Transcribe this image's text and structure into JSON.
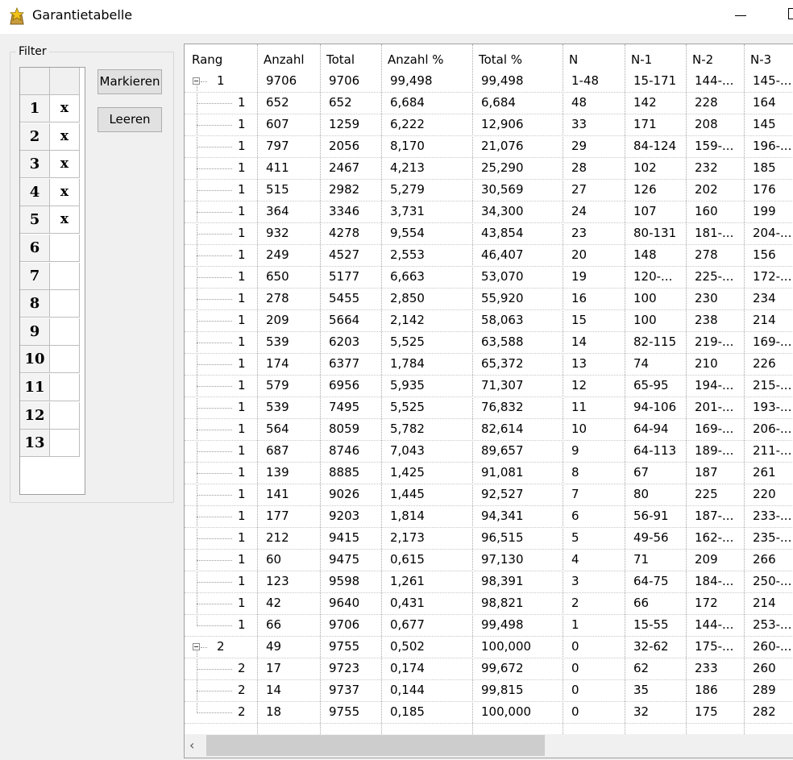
{
  "window": {
    "title": "Garantietabelle",
    "icon": "star-bag-icon"
  },
  "filter": {
    "legend": "Filter",
    "rows": [
      {
        "num": "1",
        "val": "x"
      },
      {
        "num": "2",
        "val": "x"
      },
      {
        "num": "3",
        "val": "x"
      },
      {
        "num": "4",
        "val": "x"
      },
      {
        "num": "5",
        "val": "x"
      },
      {
        "num": "6",
        "val": ""
      },
      {
        "num": "7",
        "val": ""
      },
      {
        "num": "8",
        "val": ""
      },
      {
        "num": "9",
        "val": ""
      },
      {
        "num": "10",
        "val": ""
      },
      {
        "num": "11",
        "val": ""
      },
      {
        "num": "12",
        "val": ""
      },
      {
        "num": "13",
        "val": ""
      }
    ],
    "mark_button": "Markieren",
    "clear_button": "Leeren"
  },
  "table": {
    "columns": [
      "Rang",
      "Anzahl",
      "Total",
      "Anzahl %",
      "Total %",
      "N",
      "N-1",
      "N-2",
      "N-3"
    ],
    "rows": [
      {
        "level": 0,
        "rang": "1",
        "cells": [
          "9706",
          "9706",
          "99,498",
          "99,498",
          "1-48",
          "15-171",
          "144-...",
          "145-..."
        ]
      },
      {
        "level": 1,
        "rang": "1",
        "cells": [
          "652",
          "652",
          "6,684",
          "6,684",
          "48",
          "142",
          "228",
          "164"
        ]
      },
      {
        "level": 1,
        "rang": "1",
        "cells": [
          "607",
          "1259",
          "6,222",
          "12,906",
          "33",
          "171",
          "208",
          "145"
        ]
      },
      {
        "level": 1,
        "rang": "1",
        "cells": [
          "797",
          "2056",
          "8,170",
          "21,076",
          "29",
          "84-124",
          "159-...",
          "196-..."
        ]
      },
      {
        "level": 1,
        "rang": "1",
        "cells": [
          "411",
          "2467",
          "4,213",
          "25,290",
          "28",
          "102",
          "232",
          "185"
        ]
      },
      {
        "level": 1,
        "rang": "1",
        "cells": [
          "515",
          "2982",
          "5,279",
          "30,569",
          "27",
          "126",
          "202",
          "176"
        ]
      },
      {
        "level": 1,
        "rang": "1",
        "cells": [
          "364",
          "3346",
          "3,731",
          "34,300",
          "24",
          "107",
          "160",
          "199"
        ]
      },
      {
        "level": 1,
        "rang": "1",
        "cells": [
          "932",
          "4278",
          "9,554",
          "43,854",
          "23",
          "80-131",
          "181-...",
          "204-..."
        ]
      },
      {
        "level": 1,
        "rang": "1",
        "cells": [
          "249",
          "4527",
          "2,553",
          "46,407",
          "20",
          "148",
          "278",
          "156"
        ]
      },
      {
        "level": 1,
        "rang": "1",
        "cells": [
          "650",
          "5177",
          "6,663",
          "53,070",
          "19",
          "120-...",
          "225-...",
          "172-..."
        ]
      },
      {
        "level": 1,
        "rang": "1",
        "cells": [
          "278",
          "5455",
          "2,850",
          "55,920",
          "16",
          "100",
          "230",
          "234"
        ]
      },
      {
        "level": 1,
        "rang": "1",
        "cells": [
          "209",
          "5664",
          "2,142",
          "58,063",
          "15",
          "100",
          "238",
          "214"
        ]
      },
      {
        "level": 1,
        "rang": "1",
        "cells": [
          "539",
          "6203",
          "5,525",
          "63,588",
          "14",
          "82-115",
          "219-...",
          "169-..."
        ]
      },
      {
        "level": 1,
        "rang": "1",
        "cells": [
          "174",
          "6377",
          "1,784",
          "65,372",
          "13",
          "74",
          "210",
          "226"
        ]
      },
      {
        "level": 1,
        "rang": "1",
        "cells": [
          "579",
          "6956",
          "5,935",
          "71,307",
          "12",
          "65-95",
          "194-...",
          "215-..."
        ]
      },
      {
        "level": 1,
        "rang": "1",
        "cells": [
          "539",
          "7495",
          "5,525",
          "76,832",
          "11",
          "94-106",
          "201-...",
          "193-..."
        ]
      },
      {
        "level": 1,
        "rang": "1",
        "cells": [
          "564",
          "8059",
          "5,782",
          "82,614",
          "10",
          "64-94",
          "169-...",
          "206-..."
        ]
      },
      {
        "level": 1,
        "rang": "1",
        "cells": [
          "687",
          "8746",
          "7,043",
          "89,657",
          "9",
          "64-113",
          "189-...",
          "211-..."
        ]
      },
      {
        "level": 1,
        "rang": "1",
        "cells": [
          "139",
          "8885",
          "1,425",
          "91,081",
          "8",
          "67",
          "187",
          "261"
        ]
      },
      {
        "level": 1,
        "rang": "1",
        "cells": [
          "141",
          "9026",
          "1,445",
          "92,527",
          "7",
          "80",
          "225",
          "220"
        ]
      },
      {
        "level": 1,
        "rang": "1",
        "cells": [
          "177",
          "9203",
          "1,814",
          "94,341",
          "6",
          "56-91",
          "187-...",
          "233-..."
        ]
      },
      {
        "level": 1,
        "rang": "1",
        "cells": [
          "212",
          "9415",
          "2,173",
          "96,515",
          "5",
          "49-56",
          "162-...",
          "235-..."
        ]
      },
      {
        "level": 1,
        "rang": "1",
        "cells": [
          "60",
          "9475",
          "0,615",
          "97,130",
          "4",
          "71",
          "209",
          "266"
        ]
      },
      {
        "level": 1,
        "rang": "1",
        "cells": [
          "123",
          "9598",
          "1,261",
          "98,391",
          "3",
          "64-75",
          "184-...",
          "250-..."
        ]
      },
      {
        "level": 1,
        "rang": "1",
        "cells": [
          "42",
          "9640",
          "0,431",
          "98,821",
          "2",
          "66",
          "172",
          "214"
        ]
      },
      {
        "level": 1,
        "rang": "1",
        "cells": [
          "66",
          "9706",
          "0,677",
          "99,498",
          "1",
          "15-55",
          "144-...",
          "253-..."
        ]
      },
      {
        "level": 0,
        "rang": "2",
        "cells": [
          "49",
          "9755",
          "0,502",
          "100,000",
          "0",
          "32-62",
          "175-...",
          "260-..."
        ]
      },
      {
        "level": 1,
        "rang": "2",
        "cells": [
          "17",
          "9723",
          "0,174",
          "99,672",
          "0",
          "62",
          "233",
          "260"
        ]
      },
      {
        "level": 1,
        "rang": "2",
        "cells": [
          "14",
          "9737",
          "0,144",
          "99,815",
          "0",
          "35",
          "186",
          "289"
        ]
      },
      {
        "level": 1,
        "rang": "2",
        "cells": [
          "18",
          "9755",
          "0,185",
          "100,000",
          "0",
          "32",
          "175",
          "282"
        ]
      }
    ],
    "scroll_left_icon": "chevron-left-icon"
  }
}
